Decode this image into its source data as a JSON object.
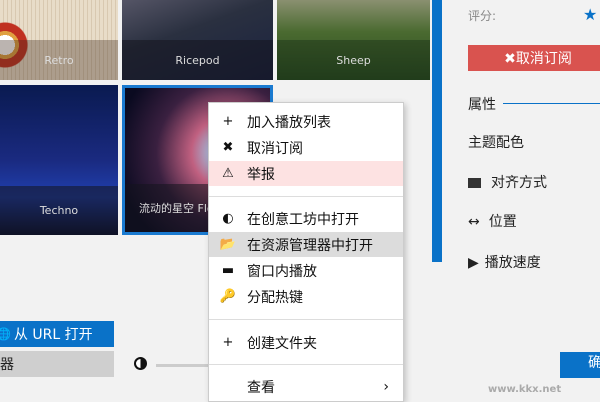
{
  "tiles": [
    {
      "label": "Retro"
    },
    {
      "label": "Ricepod"
    },
    {
      "label": "Sheep"
    },
    {
      "label": "Techno"
    },
    {
      "label": "流动的星空 Flo"
    }
  ],
  "context_menu": {
    "items": [
      {
        "icon": "+",
        "label": "加入播放列表"
      },
      {
        "icon": "✖",
        "label": "取消订阅"
      },
      {
        "icon": "⚠",
        "label": "举报"
      },
      {
        "icon": "◐",
        "label": "在创意工坊中打开"
      },
      {
        "icon": "📂",
        "label": "在资源管理器中打开"
      },
      {
        "icon": "▬",
        "label": "窗口内播放"
      },
      {
        "icon": "🔑",
        "label": "分配热键"
      },
      {
        "icon": "+",
        "label": "创建文件夹"
      },
      {
        "icon": "",
        "label": "查看",
        "chevron": "›"
      }
    ]
  },
  "left": {
    "open_url": "从 URL 打开",
    "open_url_icon": "🌐",
    "grey_button": "器"
  },
  "right": {
    "rating_label": "评分:",
    "star": "★",
    "unsubscribe": "✖取消订阅",
    "properties": "属性",
    "theme_color": "主题配色",
    "alignment": "对齐方式",
    "position": "位置",
    "playback_speed": "播放速度",
    "ok_button": "确定"
  },
  "watermark": "www.kkx.net",
  "colors": {
    "accent": "#0a72c8",
    "danger": "#d9534f"
  }
}
